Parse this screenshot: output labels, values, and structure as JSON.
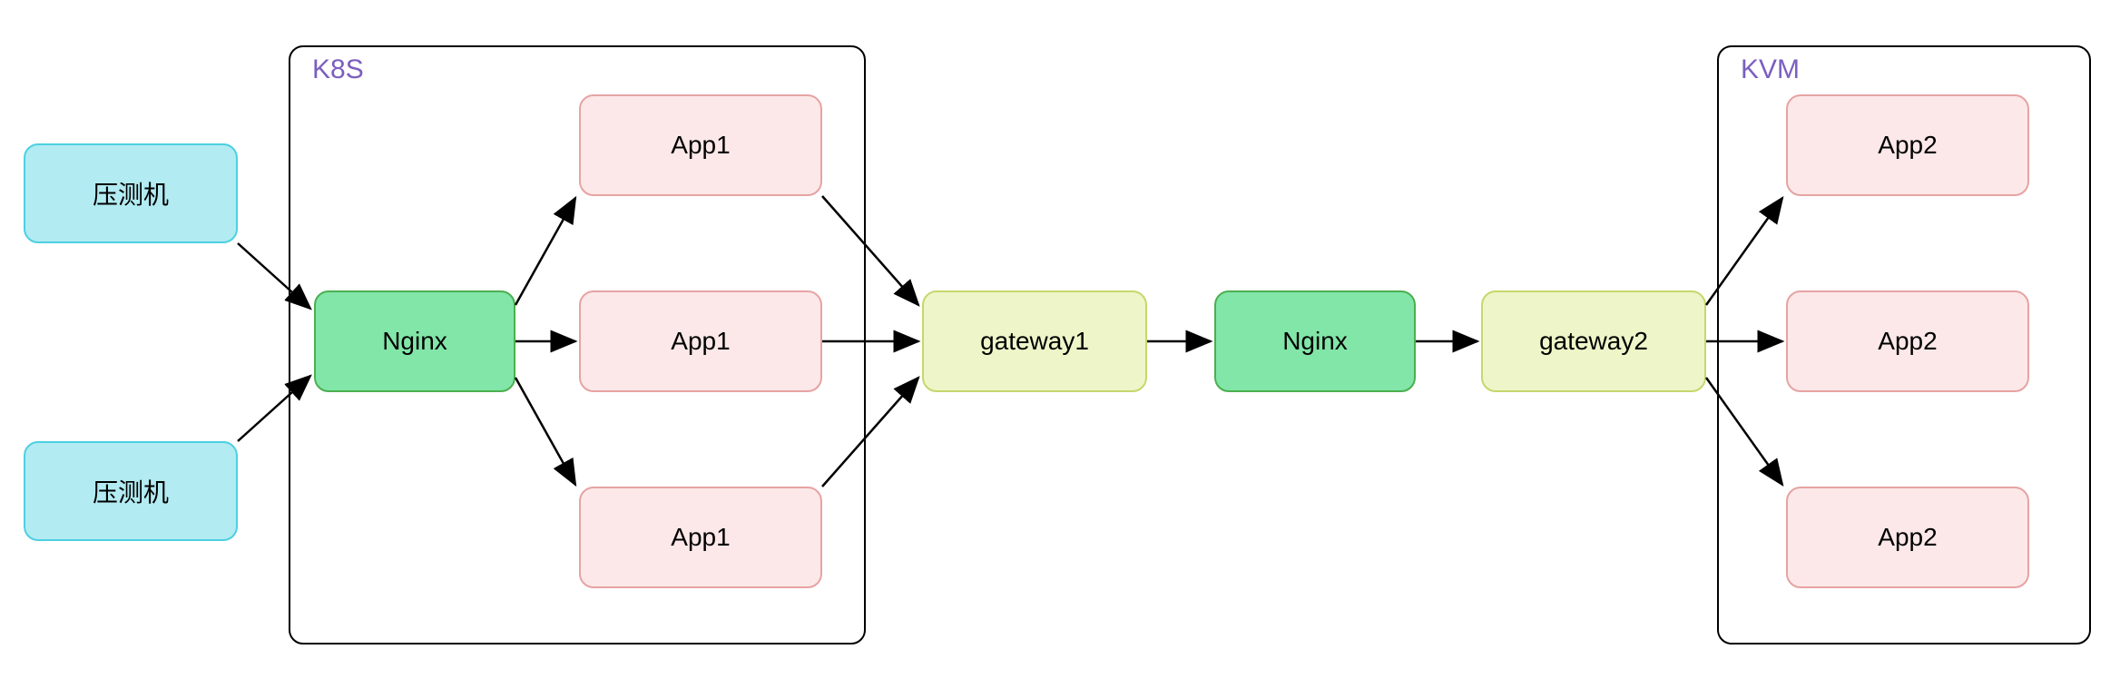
{
  "containers": {
    "k8s": {
      "label": "K8S"
    },
    "kvm": {
      "label": "KVM"
    }
  },
  "nodes": {
    "load1": {
      "label": "压测机"
    },
    "load2": {
      "label": "压测机"
    },
    "nginx1": {
      "label": "Nginx"
    },
    "app1_a": {
      "label": "App1"
    },
    "app1_b": {
      "label": "App1"
    },
    "app1_c": {
      "label": "App1"
    },
    "gateway1": {
      "label": "gateway1"
    },
    "nginx2": {
      "label": "Nginx"
    },
    "gateway2": {
      "label": "gateway2"
    },
    "app2_a": {
      "label": "App2"
    },
    "app2_b": {
      "label": "App2"
    },
    "app2_c": {
      "label": "App2"
    }
  }
}
